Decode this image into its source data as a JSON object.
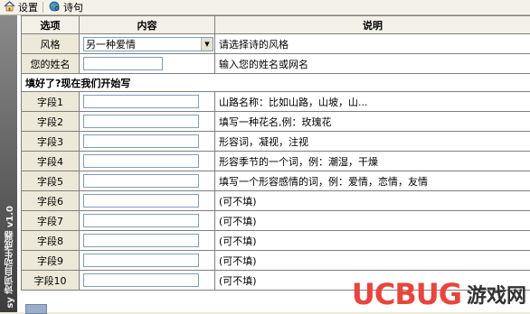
{
  "toolbar": {
    "settings_label": "设置",
    "poem_label": "诗句"
  },
  "sidebar": {
    "title": "sy 诗词自动生成器 v1.0"
  },
  "table": {
    "headers": [
      "选项",
      "内容",
      "说明"
    ],
    "style_row": {
      "label": "风格",
      "value": "另一种爱情",
      "desc": "请选择诗的风格"
    },
    "name_row": {
      "label": "您的姓名",
      "value": "",
      "desc": "输入您的姓名或网名"
    },
    "section_title": "填好了?现在我们开始写",
    "fields": [
      {
        "label": "字段1",
        "desc": "山路名称：比如山路，山坡，山..."
      },
      {
        "label": "字段2",
        "desc": "填写一种花名,例：玫瑰花"
      },
      {
        "label": "字段3",
        "desc": "形容词，凝视，注视"
      },
      {
        "label": "字段4",
        "desc": "形容季节的一个词，例：潮湿，干燥"
      },
      {
        "label": "字段5",
        "desc": "填写一个形容感情的词，例：爱情，恋情，友情"
      },
      {
        "label": "字段6",
        "desc": "(可不填)"
      },
      {
        "label": "字段7",
        "desc": "(可不填)"
      },
      {
        "label": "字段8",
        "desc": "(可不填)"
      },
      {
        "label": "字段9",
        "desc": "(可不填)"
      },
      {
        "label": "字段10",
        "desc": "(可不填)"
      }
    ]
  },
  "watermark": {
    "brand": "UCBUG",
    "site": "游戏网",
    "brand_color": "#e8453c"
  }
}
